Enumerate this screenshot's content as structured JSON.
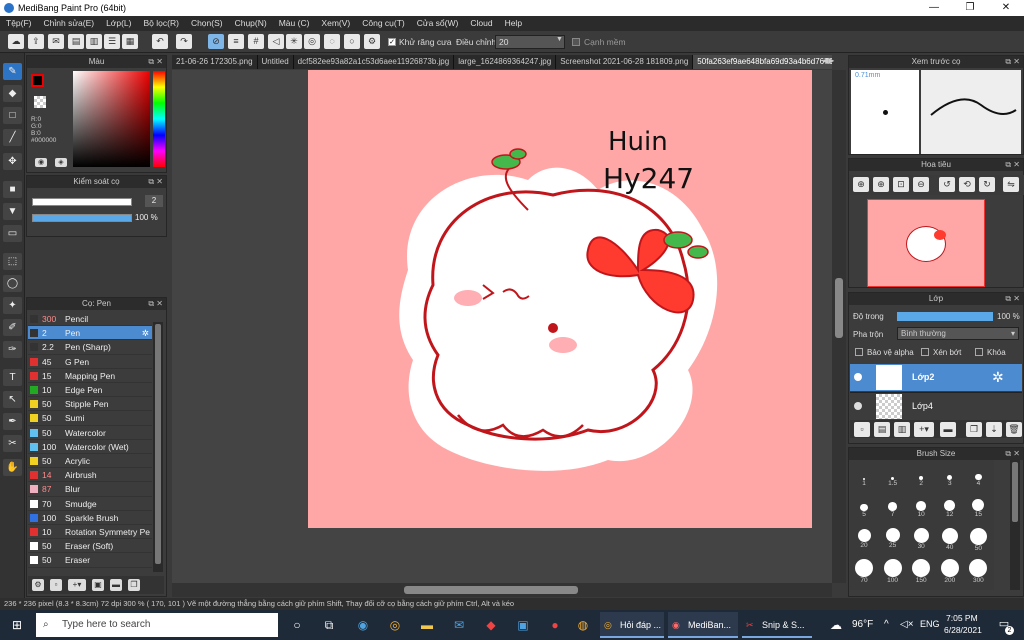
{
  "window": {
    "title": "MediBang Paint Pro (64bit)",
    "minimize": "—",
    "maximize": "❐",
    "close": "✕"
  },
  "menu": [
    "Tệp(F)",
    "Chỉnh sửa(E)",
    "Lớp(L)",
    "Bộ lọc(R)",
    "Chọn(S)",
    "Chụp(N)",
    "Màu (C)",
    "Xem(V)",
    "Công cụ(T)",
    "Cửa sổ(W)",
    "Cloud",
    "Help"
  ],
  "toolbar": {
    "antialias_label": "Khử răng cưa",
    "adjust_label": "Điều chỉnh",
    "adjust_value": "20",
    "edge_label": "Cạnh mềm"
  },
  "panels": {
    "color": {
      "title": "Màu",
      "r": "R:0",
      "g": "G:0",
      "b": "B:0",
      "hex": "#000000"
    },
    "brush_control": {
      "title": "Kiểm soát cọ",
      "size": "2",
      "opacity": "100 %"
    },
    "brush": {
      "title": "Cọ: Pen"
    },
    "preview": {
      "title": "Xem trước cọ",
      "size": "0.71mm"
    },
    "navigator": {
      "title": "Hoa tiêu"
    },
    "layer": {
      "title": "Lớp",
      "opacity_label": "Độ trong",
      "opacity_value": "100 %",
      "blend_label": "Pha trộn",
      "blend_value": "Bình thường",
      "protect_alpha": "Bảo vệ alpha",
      "clipping": "Xén bớt",
      "lock": "Khóa"
    },
    "brush_size": {
      "title": "Brush Size"
    }
  },
  "brushes": [
    {
      "size": "300",
      "name": "Pencil",
      "color": "#333333"
    },
    {
      "size": "2",
      "name": "Pen",
      "color": "#333333",
      "selected": true
    },
    {
      "size": "2.2",
      "name": "Pen (Sharp)",
      "color": "#333333"
    },
    {
      "size": "45",
      "name": "G Pen",
      "color": "#e03030"
    },
    {
      "size": "15",
      "name": "Mapping Pen",
      "color": "#e03030"
    },
    {
      "size": "10",
      "name": "Edge Pen",
      "color": "#22aa22"
    },
    {
      "size": "50",
      "name": "Stipple Pen",
      "color": "#f0d020"
    },
    {
      "size": "50",
      "name": "Sumi",
      "color": "#f0d020"
    },
    {
      "size": "50",
      "name": "Watercolor",
      "color": "#60c0f0"
    },
    {
      "size": "100",
      "name": "Watercolor (Wet)",
      "color": "#60c0f0"
    },
    {
      "size": "50",
      "name": "Acrylic",
      "color": "#f0d020"
    },
    {
      "size": "14",
      "name": "Airbrush",
      "color": "#e03030"
    },
    {
      "size": "87",
      "name": "Blur",
      "color": "#f0b0c0"
    },
    {
      "size": "70",
      "name": "Smudge",
      "color": "#ffffff"
    },
    {
      "size": "100",
      "name": "Sparkle Brush",
      "color": "#3070e0"
    },
    {
      "size": "10",
      "name": "Rotation Symmetry Pe",
      "color": "#e03030"
    },
    {
      "size": "50",
      "name": "Eraser (Soft)",
      "color": "#ffffff"
    },
    {
      "size": "50",
      "name": "Eraser",
      "color": "#ffffff"
    }
  ],
  "tabs": [
    "21-06-26 172305.png",
    "Untitled",
    "dcf582ee93a82a1c53d6aee11926873b.jpg",
    "large_1624869364247.jpg",
    "Screenshot 2021-06-28 181809.png",
    "50fa263ef9ae648bfa69d93a4b6d7676.jpg"
  ],
  "layers": [
    {
      "name": "Lớp2",
      "selected": true
    },
    {
      "name": "Lớp4",
      "selected": false
    }
  ],
  "brush_sizes": [
    "1",
    "1.5",
    "2",
    "3",
    "4",
    "5",
    "7",
    "10",
    "12",
    "15",
    "20",
    "25",
    "30",
    "40",
    "50",
    "70",
    "100",
    "150",
    "200",
    "300"
  ],
  "drawing": {
    "handwriting_1": "Huin",
    "handwriting_2": "Hy247"
  },
  "status": "236 * 236 pixel  (8.3 * 8.3cm)  72 dpi  300 %  ( 170, 101 )  Vẽ một đường thẳng bằng cách giữ phím Shift, Thay đổi cỡ cọ bằng cách giữ phím Ctrl, Alt và kéo",
  "taskbar": {
    "search_placeholder": "Type here to search",
    "app1": "Hỏi đáp ...",
    "app2": "MediBan...",
    "app3": "Snip & S...",
    "weather": "96°F",
    "lang": "ENG",
    "time": "7:05 PM",
    "date": "6/28/2021",
    "notif": "2"
  }
}
